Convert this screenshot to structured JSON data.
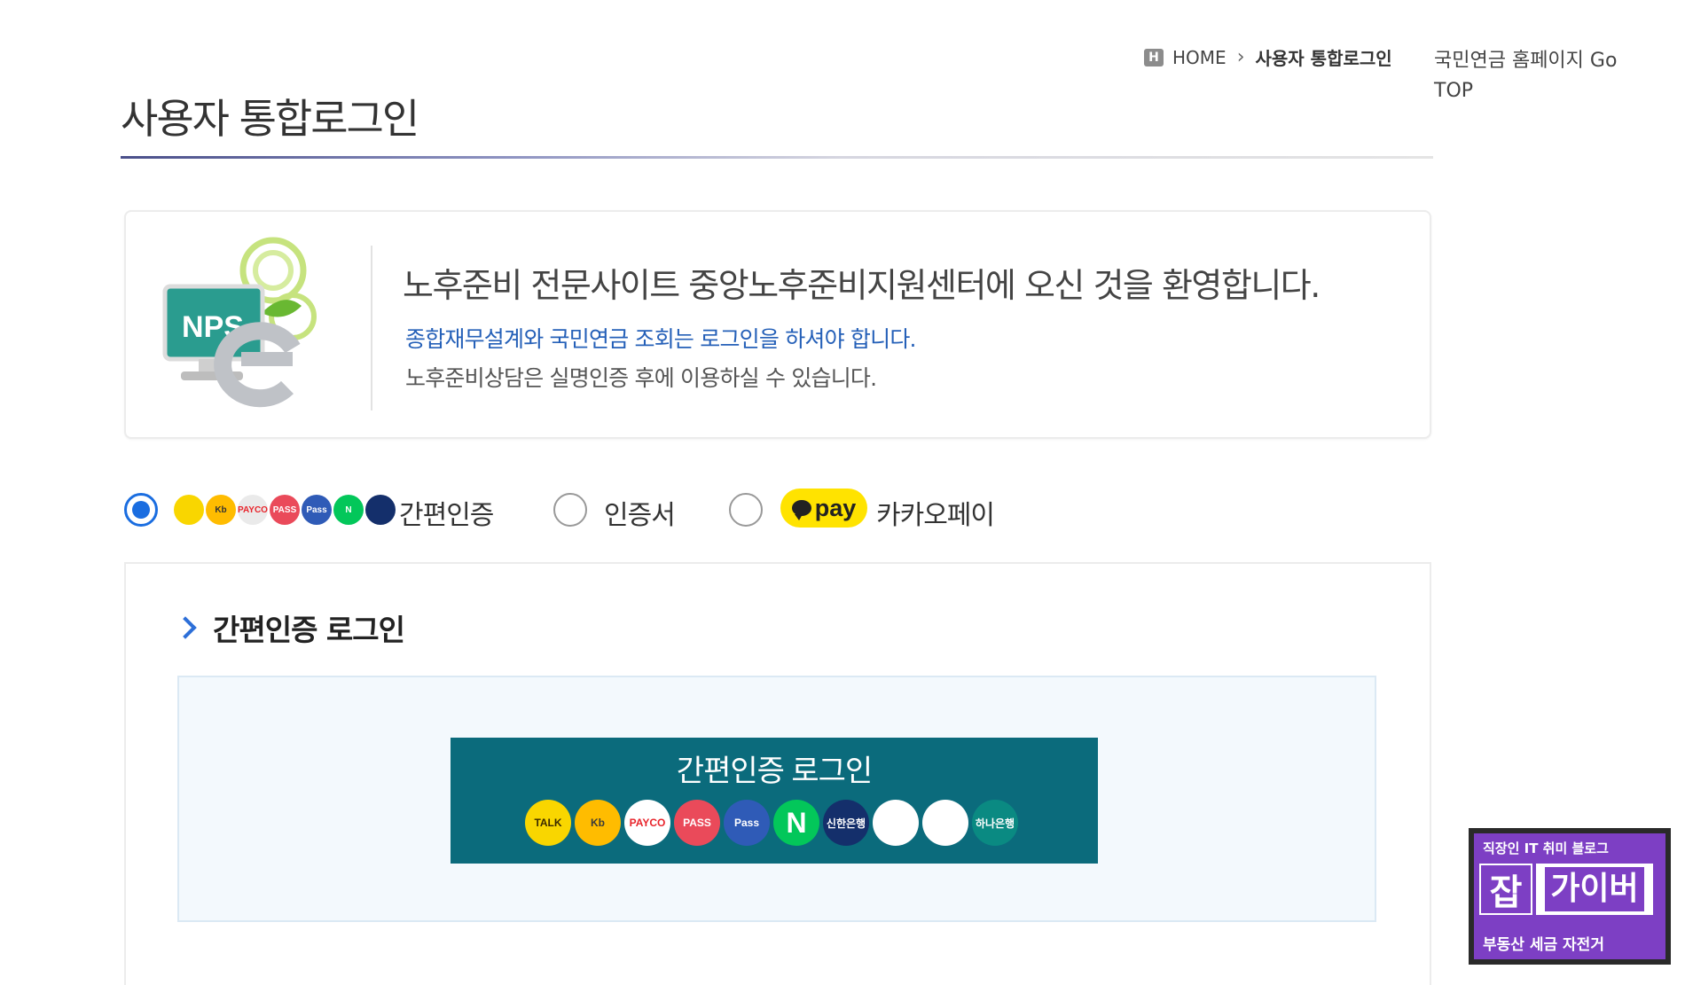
{
  "breadcrumb": {
    "home_icon": "H",
    "home": "HOME",
    "current": "사용자 통합로그인"
  },
  "nps_link": "국민연금 홈페이지 Go TOP",
  "page_title": "사용자 통합로그인",
  "welcome": {
    "logo_text": "NPS",
    "heading": "노후준비 전문사이트 중앙노후준비지원센터에 오신 것을 환영합니다.",
    "notice": "종합재무설계와 국민연금 조회는 로그인을 하셔야 합니다.",
    "sub": "노후준비상담은 실명인증 후에 이용하실 수 있습니다."
  },
  "login_methods": {
    "simple": "간편인증",
    "certificate": "인증서",
    "kakaopay_badge": "pay",
    "kakaopay": "카카오페이",
    "selected": "simple"
  },
  "mini_icons": [
    {
      "name": "kakaotalk-icon",
      "color": "#f9d600",
      "text": ""
    },
    {
      "name": "kb-icon",
      "color": "#ffbc00",
      "text": "Kb"
    },
    {
      "name": "payco-icon",
      "color": "#eaeaea",
      "text": "PAYCO"
    },
    {
      "name": "pass-icon",
      "color": "#ea4a5a",
      "text": "PASS"
    },
    {
      "name": "samsung-pass-icon",
      "color": "#2f5bb7",
      "text": "Pass"
    },
    {
      "name": "naver-icon",
      "color": "#03c75a",
      "text": "N"
    },
    {
      "name": "shinhan-icon",
      "color": "#142f6b",
      "text": ""
    }
  ],
  "section_title": "간편인증 로그인",
  "simple_button": {
    "label": "간편인증 로그인",
    "icons": [
      {
        "name": "kakaotalk-icon",
        "color": "#f9d600",
        "text": "TALK",
        "fg": "#3a2a00"
      },
      {
        "name": "kb-icon",
        "color": "#ffbc00",
        "text": "Kb",
        "fg": "#3a3a3a"
      },
      {
        "name": "payco-icon",
        "color": "#ffffff",
        "text": "PAYCO",
        "fg": "#e8242b"
      },
      {
        "name": "pass-icon",
        "color": "#ea4a5a",
        "text": "PASS",
        "fg": "#ffffff"
      },
      {
        "name": "samsung-pass-icon",
        "color": "#2f5bb7",
        "text": "Pass",
        "fg": "#ffffff"
      },
      {
        "name": "naver-icon",
        "color": "#03c75a",
        "text": "N",
        "fg": "#ffffff"
      },
      {
        "name": "shinhan-icon",
        "color": "#142f6b",
        "text": "신한은행",
        "fg": "#ffffff"
      },
      {
        "name": "toss-icon",
        "color": "#ffffff",
        "text": "",
        "fg": "#1b64da"
      },
      {
        "name": "banksalad-icon",
        "color": "#ffffff",
        "text": "",
        "fg": "#11b37c"
      },
      {
        "name": "hana-icon",
        "color": "#0a8a82",
        "text": "하나은행",
        "fg": "#ffffff"
      }
    ]
  },
  "watermark": {
    "line1": "직장인 IT 취미 블로그",
    "jab": "잡",
    "gaiver": "가이버",
    "line2": "부동산 세금 자전거"
  }
}
